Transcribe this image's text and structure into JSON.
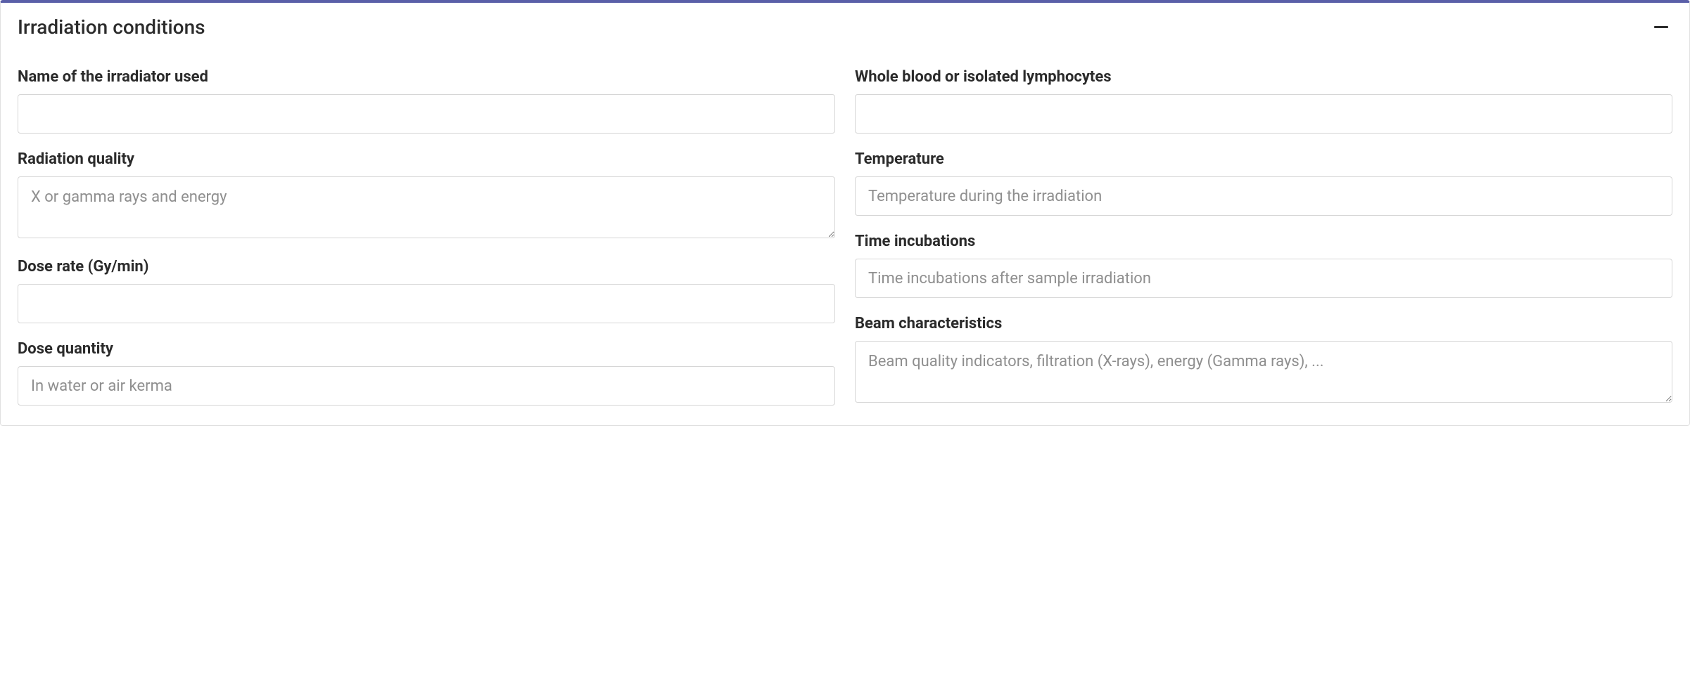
{
  "panel": {
    "title": "Irradiation conditions"
  },
  "left": {
    "irradiator": {
      "label": "Name of the irradiator used",
      "value": "",
      "placeholder": ""
    },
    "radiation_quality": {
      "label": "Radiation quality",
      "value": "",
      "placeholder": "X or gamma rays and energy"
    },
    "dose_rate": {
      "label": "Dose rate (Gy/min)",
      "value": "",
      "placeholder": ""
    },
    "dose_quantity": {
      "label": "Dose quantity",
      "value": "",
      "placeholder": "In water or air kerma"
    }
  },
  "right": {
    "blood_type": {
      "label": "Whole blood or isolated lymphocytes",
      "value": "",
      "placeholder": ""
    },
    "temperature": {
      "label": "Temperature",
      "value": "",
      "placeholder": "Temperature during the irradiation"
    },
    "time_incubations": {
      "label": "Time incubations",
      "value": "",
      "placeholder": "Time incubations after sample irradiation"
    },
    "beam_characteristics": {
      "label": "Beam characteristics",
      "value": "",
      "placeholder": "Beam quality indicators, filtration (X-rays), energy (Gamma rays), ..."
    }
  }
}
